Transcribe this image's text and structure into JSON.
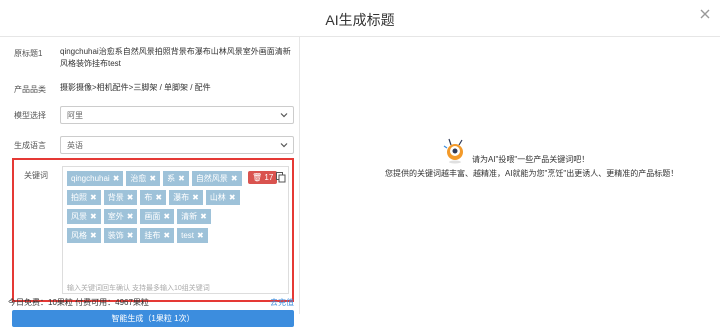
{
  "dialog": {
    "title": "AI生成标题"
  },
  "form": {
    "original_title_label": "原标题1",
    "original_title_value": "qingchuhai治愈系自然风景拍照背景布瀑布山林风景室外画面清新风格装饰挂布test",
    "category_label": "产品品类",
    "category_value": "摄影摄像>相机配件>三脚架 / 单脚架 / 配件",
    "model_label": "模型选择",
    "model_value": "阿里",
    "language_label": "生成语言",
    "language_value": "英语",
    "keywords_label": "关键词",
    "keywords": [
      "qingchuhai",
      "治愈",
      "系",
      "自然风景",
      "拍照",
      "背景",
      "布",
      "瀑布",
      "山林",
      "风景",
      "室外",
      "画面",
      "清新",
      "风格",
      "装饰",
      "挂布",
      "test"
    ],
    "keyword_count": "17",
    "keywords_hint": "输入关键词回车确认   支持最多输入10组关键词",
    "generate_button": "智能生成（1果粒 1次）",
    "quota_text": "今日免费：10果粒 付费可用：4967果粒",
    "recharge_link": "去充值"
  },
  "right_panel": {
    "message_line1": "请为AI\"投喂\"一些产品关键词吧！",
    "message_line2": "您提供的关键词越丰富、越精准，AI就能为您\"烹饪\"出更诱人、更精准的产品标题！"
  },
  "colors": {
    "accent": "#3c8dde",
    "tag_bg": "#9ec2d9",
    "badge_red": "#d9534f",
    "highlight_border": "#e53935"
  },
  "icons": [
    "close-icon",
    "chevron-down-icon",
    "trash-icon",
    "copy-icon",
    "mascot-icon"
  ]
}
